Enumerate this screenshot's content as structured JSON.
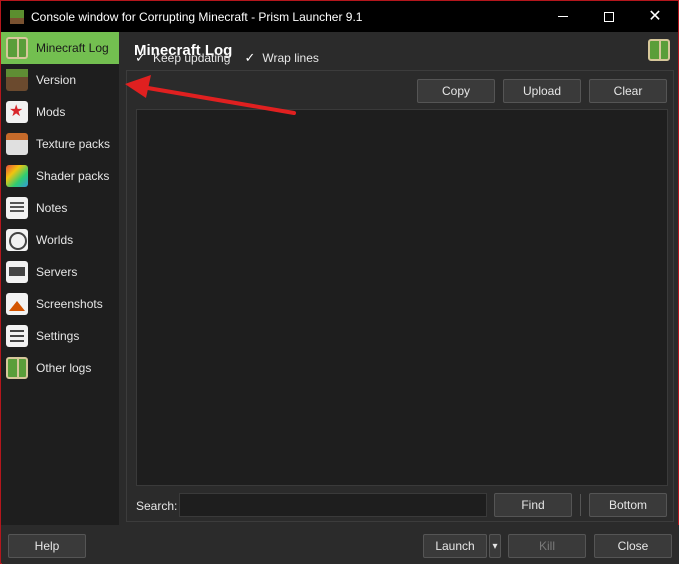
{
  "window": {
    "title": "Console window for Corrupting Minecraft - Prism Launcher 9.1",
    "accent_border": "#b4161c",
    "controls": {
      "minimize": "—",
      "maximize": "☐",
      "close": "✕"
    }
  },
  "sidebar": {
    "active_color": "#73bf50",
    "items": [
      {
        "label": "Minecraft Log",
        "icon": "book-icon",
        "active": true
      },
      {
        "label": "Version",
        "icon": "grass-block-icon"
      },
      {
        "label": "Mods",
        "icon": "mods-star-icon"
      },
      {
        "label": "Texture packs",
        "icon": "texture-pack-icon"
      },
      {
        "label": "Shader packs",
        "icon": "shader-cube-icon"
      },
      {
        "label": "Notes",
        "icon": "notes-icon"
      },
      {
        "label": "Worlds",
        "icon": "world-icon"
      },
      {
        "label": "Servers",
        "icon": "server-icon"
      },
      {
        "label": "Screenshots",
        "icon": "screenshot-icon"
      },
      {
        "label": "Settings",
        "icon": "settings-icon"
      },
      {
        "label": "Other logs",
        "icon": "book-icon"
      }
    ]
  },
  "main": {
    "title": "Minecraft Log",
    "keep_updating": {
      "label": "Keep updating",
      "checked": true
    },
    "wrap_lines": {
      "label": "Wrap lines",
      "checked": true
    },
    "buttons": {
      "copy": "Copy",
      "upload": "Upload",
      "clear": "Clear"
    },
    "log_text": "",
    "search": {
      "label": "Search:",
      "value": "",
      "placeholder": ""
    },
    "find": "Find",
    "bottom": "Bottom"
  },
  "footer": {
    "help": "Help",
    "launch": "Launch",
    "launch_dropdown": "▾",
    "kill": "Kill",
    "close": "Close"
  },
  "annotation": {
    "color": "#e02020"
  }
}
